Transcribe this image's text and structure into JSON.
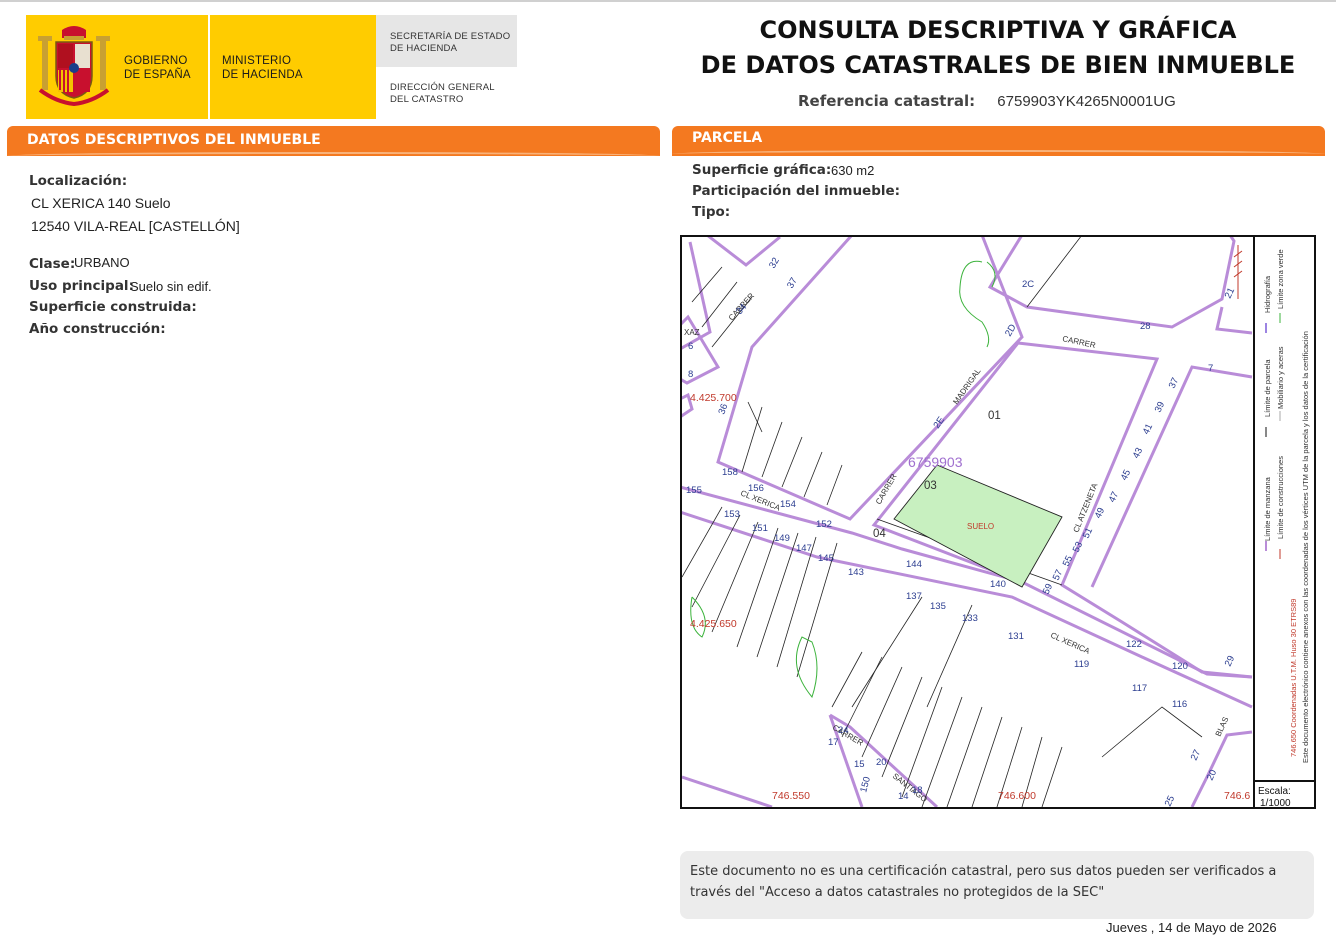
{
  "header": {
    "logo": {
      "gobierno": [
        "GOBIERNO",
        "DE ESPAÑA"
      ],
      "ministerio": [
        "MINISTERIO",
        "DE HACIENDA"
      ],
      "secretaria": [
        "SECRETARÍA DE ESTADO",
        "DE HACIENDA"
      ],
      "direccion": [
        "DIRECCIÓN GENERAL",
        "DEL CATASTRO"
      ]
    },
    "title_line1": "CONSULTA DESCRIPTIVA Y GRÁFICA",
    "title_line2": "DE DATOS CATASTRALES DE BIEN INMUEBLE",
    "ref_label": "Referencia catastral:",
    "ref_value": "6759903YK4265N0001UG"
  },
  "left": {
    "section_title": "DATOS DESCRIPTIVOS DEL INMUEBLE",
    "localizacion_label": "Localización:",
    "localizacion_line1": "CL XERICA 140 Suelo",
    "localizacion_line2": "12540 VILA-REAL [CASTELLÓN]",
    "clase_label": "Clase:",
    "clase_value": "URBANO",
    "uso_label": "Uso principal:",
    "uso_value": "Suelo sin edif.",
    "superficie_label": "Superficie construida:",
    "anio_label": "Año construcción:"
  },
  "right": {
    "section_title": "PARCELA",
    "superficie_label": "Superficie gráfica:",
    "superficie_value": "630 m2",
    "participacion_label": "Participación del inmueble:",
    "tipo_label": "Tipo:"
  },
  "map": {
    "parcel_ref": "6759903",
    "suelo_label": "SUELO",
    "coords": {
      "y_4425700": "4.425.700",
      "y_4425650": "4.425.650",
      "x_746550": "746.550",
      "x_746600": "746.600",
      "x_7466": "746.6"
    },
    "street_labels": {
      "carrer_top_left": "CARRER",
      "carrer_top_right": "CARRER",
      "madrigal": "MADRIGAL",
      "carrer_mid": "CARRER",
      "cl_xerica_left": "CL XERICA",
      "cl_xerica_right": "CL XERICA",
      "cl_atzeneta": "CL ATZENETA",
      "blas": "BLAS",
      "carrer_bottom": "CARRER",
      "san_bottom": "SANTIAGO",
      "xaz": "XAZ"
    },
    "lot_numbers": {
      "n01": "01",
      "n03": "03",
      "n04": "04",
      "n34": "34",
      "n32": "32",
      "n37a": "37",
      "n2c": "2C",
      "n28": "28",
      "n21": "21",
      "n2d": "2D",
      "n2e": "2E",
      "n7": "7",
      "n37b": "37",
      "n39": "39",
      "n41": "41",
      "n43": "43",
      "n45": "45",
      "n47": "47",
      "n49": "49",
      "n51": "51",
      "n53": "53",
      "n55": "55",
      "n57": "57",
      "n59": "59",
      "n6": "6",
      "n8": "8",
      "n36": "36",
      "n158": "158",
      "n156": "156",
      "n154": "154",
      "n152": "152",
      "n155": "155",
      "n153": "153",
      "n151": "151",
      "n149": "149",
      "n147": "147",
      "n145": "145",
      "n143": "143",
      "n144": "144",
      "n140": "140",
      "n137": "137",
      "n135": "135",
      "n133": "133",
      "n131": "131",
      "n122": "122",
      "n120": "120",
      "n119": "119",
      "n117": "117",
      "n116": "116",
      "n29": "29",
      "n27": "27",
      "n25": "25",
      "n20a": "20",
      "n20b": "20",
      "n15": "15",
      "n17": "17",
      "n150": "150",
      "n14": "14",
      "n24": "24",
      "n18": "18"
    },
    "legend": {
      "line1_a": "Límite de manzana",
      "line1_b": "Límite de parcela",
      "line1_c": "Hidrografía",
      "line2_a": "Límite de construcciones",
      "line2_b": "Mobiliario y aceras",
      "line2_c": "Límite zona verde",
      "coords_note": "746.650 Coordenadas U.T.M. Huso 30 ETRS89",
      "doc_note": "Este documento electrónico contiene anexos con las coordenadas de los vértices UTM de la parcela y los datos de la certificación"
    },
    "escala_label": "Escala:",
    "escala_value": "1/1000"
  },
  "footer": {
    "note": "Este documento no es una certificación catastral, pero sus datos pueden ser verificados a través del \"Acceso a datos catastrales no protegidos de la SEC\"",
    "date": "Jueves , 14 de Mayo de 2026"
  },
  "colors": {
    "orange": "#f47920",
    "yellow": "#ffcc00",
    "block_line": "#b98cd8",
    "parcel_fill": "#c8f0c0",
    "coord_red": "#c0392b",
    "lot_number": "#2c3e90"
  }
}
